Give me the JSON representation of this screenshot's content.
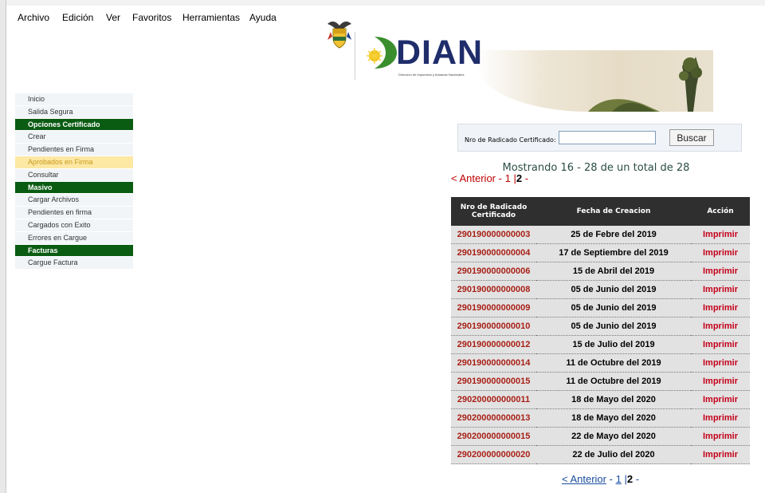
{
  "menubar": {
    "items": [
      "Archivo",
      "Edición",
      "Ver",
      "Favoritos",
      "Herramientas",
      "Ayuda"
    ]
  },
  "header": {
    "logo_text": "DIAN",
    "logo_subtitle": "Dirección de Impuestos y Aduanas Nacionales"
  },
  "sidebar": {
    "groups": [
      {
        "type": "item",
        "label": "Inicio"
      },
      {
        "type": "item",
        "label": "Salida Segura"
      },
      {
        "type": "section",
        "label": "Opciones Certificado"
      },
      {
        "type": "item",
        "label": "Crear"
      },
      {
        "type": "item",
        "label": "Pendientes en Firma"
      },
      {
        "type": "item",
        "label": "Aprobados en Firma",
        "active": true
      },
      {
        "type": "item",
        "label": "Consultar"
      },
      {
        "type": "section",
        "label": "Masivo"
      },
      {
        "type": "item",
        "label": "Cargar Archivos"
      },
      {
        "type": "item",
        "label": "Pendientes en firma"
      },
      {
        "type": "item",
        "label": "Cargados con Exito"
      },
      {
        "type": "item",
        "label": "Errores en Cargue"
      },
      {
        "type": "section",
        "label": "Facturas"
      },
      {
        "type": "item",
        "label": "Cargue Factura"
      }
    ]
  },
  "search": {
    "label": "Nro de Radicado Certificado:",
    "value": "",
    "button": "Buscar"
  },
  "results": {
    "summary": "Mostrando 16 - 28 de un total de 28",
    "pager": {
      "prev": "< Anterior",
      "sep": "-",
      "page1": "1",
      "bar": "|",
      "page2": "2",
      "trail": "-"
    },
    "columns": [
      "Nro de Radicado Certificado",
      "Fecha de Creacion",
      "Acción"
    ],
    "rows": [
      {
        "num": "290190000000003",
        "fecha": "25 de Febre del 2019",
        "accion": "Imprimir"
      },
      {
        "num": "290190000000004",
        "fecha": "17 de Septiembre del 2019",
        "accion": "Imprimir"
      },
      {
        "num": "290190000000006",
        "fecha": "15 de Abril del 2019",
        "accion": "Imprimir"
      },
      {
        "num": "290190000000008",
        "fecha": "05 de Junio del 2019",
        "accion": "Imprimir"
      },
      {
        "num": "290190000000009",
        "fecha": "05 de Junio del 2019",
        "accion": "Imprimir"
      },
      {
        "num": "290190000000010",
        "fecha": "05 de Junio del 2019",
        "accion": "Imprimir"
      },
      {
        "num": "290190000000012",
        "fecha": "15 de Julio del 2019",
        "accion": "Imprimir"
      },
      {
        "num": "290190000000014",
        "fecha": "11 de Octubre del 2019",
        "accion": "Imprimir"
      },
      {
        "num": "290190000000015",
        "fecha": "11 de Octubre del 2019",
        "accion": "Imprimir"
      },
      {
        "num": "290200000000011",
        "fecha": "18 de Mayo del 2020",
        "accion": "Imprimir"
      },
      {
        "num": "290200000000013",
        "fecha": "18 de Mayo del 2020",
        "accion": "Imprimir"
      },
      {
        "num": "290200000000015",
        "fecha": "22 de Mayo del 2020",
        "accion": "Imprimir"
      },
      {
        "num": "290200000000020",
        "fecha": "22 de Julio del 2020",
        "accion": "Imprimir"
      }
    ]
  },
  "colors": {
    "section_green": "#0b5c13",
    "link_red": "#a81f16",
    "header_dark": "#2f2f2f",
    "active_highlight": "#fde8a4"
  }
}
